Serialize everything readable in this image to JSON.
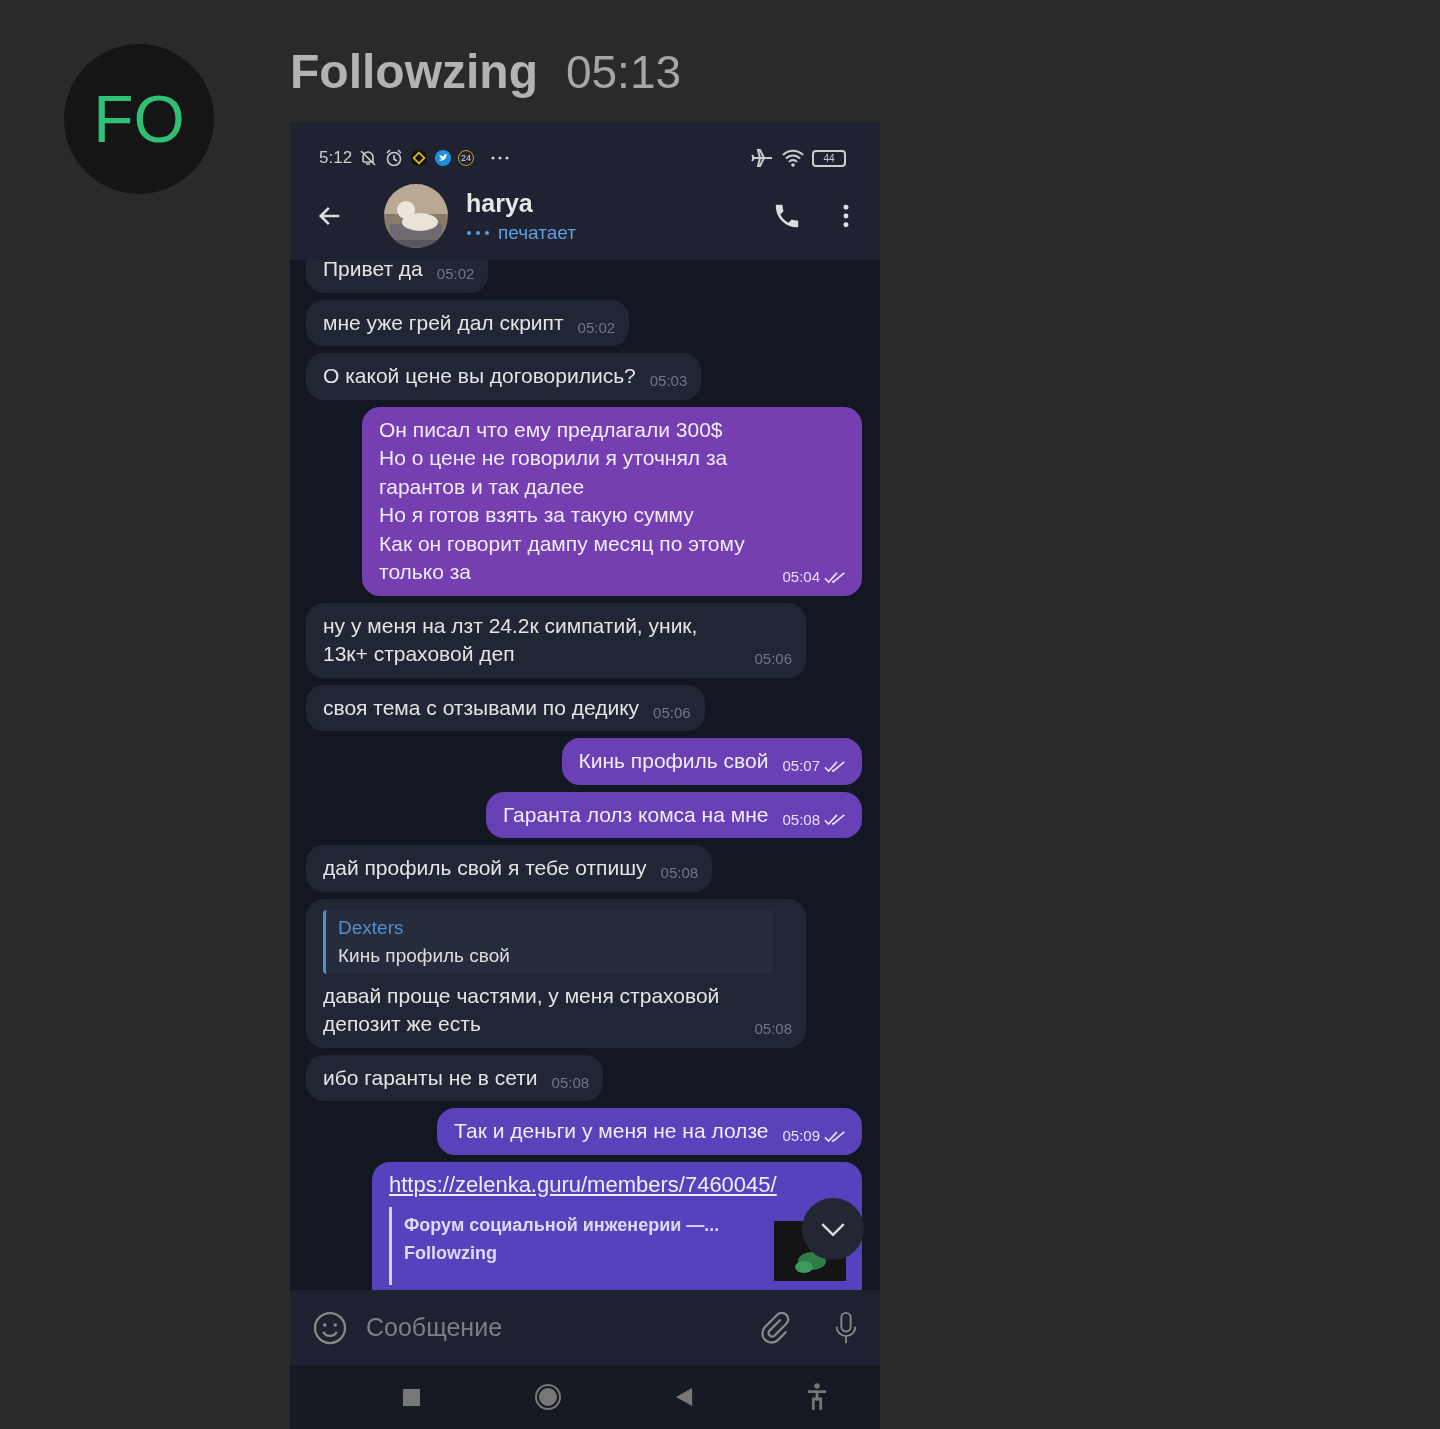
{
  "post": {
    "avatar_initials": "FO",
    "author": "Followzing",
    "time": "05:13"
  },
  "status_bar": {
    "time": "5:12",
    "badge": "24",
    "battery": "44"
  },
  "chat_header": {
    "name": "harya",
    "status": "печатает",
    "typing": true
  },
  "messages": [
    {
      "kind": "incoming",
      "text": "Привет да",
      "time": "05:02"
    },
    {
      "kind": "incoming",
      "text": "мне уже грей дал скрипт",
      "time": "05:02"
    },
    {
      "kind": "incoming",
      "text": "О какой цене вы договорились?",
      "time": "05:03"
    },
    {
      "kind": "outgoing",
      "text": "Он писал что ему предлагали 300$\nНо о цене не говорили я уточнял за гарантов и так далее\nНо я готов взять за такую сумму\nКак он говорит дампу месяц по этому только за",
      "time": "05:04",
      "read": true
    },
    {
      "kind": "incoming",
      "text": "ну у меня на лзт 24.2к симпатий, уник, 13к+ страховой деп",
      "time": "05:06"
    },
    {
      "kind": "incoming",
      "text": "своя тема с отзывами по дедику",
      "time": "05:06"
    },
    {
      "kind": "outgoing",
      "text": "Кинь профиль свой",
      "time": "05:07",
      "read": true
    },
    {
      "kind": "outgoing",
      "text": "Гаранта лолз комса на мне",
      "time": "05:08",
      "read": true
    },
    {
      "kind": "incoming",
      "text": "дай профиль свой я тебе отпишу",
      "time": "05:08"
    },
    {
      "kind": "incoming",
      "text": "давай проще частями, у меня страховой депозит же есть",
      "time": "05:08",
      "reply": {
        "author": "Dexters",
        "text": "Кинь профиль свой"
      }
    },
    {
      "kind": "incoming",
      "text": "ибо гаранты не в сети",
      "time": "05:08"
    },
    {
      "kind": "outgoing",
      "text": "Так и деньги у меня не на лолзе",
      "time": "05:09",
      "read": true
    },
    {
      "kind": "link",
      "url": "https://zelenka.guru/members/7460045/",
      "preview_title": "Форум социальной инженерии —...",
      "preview_site": "Followzing"
    }
  ],
  "composer": {
    "placeholder": "Сообщение"
  }
}
